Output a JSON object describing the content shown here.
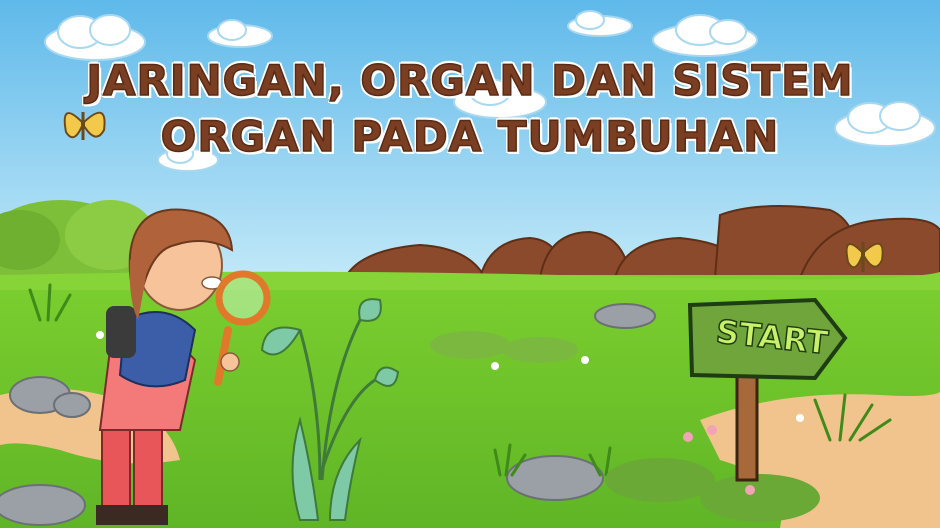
{
  "title": {
    "line1": "JARINGAN, ORGAN DAN SISTEM",
    "line2": "ORGAN PADA TUMBUHAN"
  },
  "start_button": {
    "label": "START"
  },
  "colors": {
    "sky_top": "#5fb9ea",
    "sky_bottom": "#bfe6f7",
    "grass": "#6fc42a",
    "grass_dark": "#4e9b1e",
    "rock": "#8b4a2b",
    "path": "#f1c48e",
    "title_text": "#7a3f22",
    "sign_board": "#6fa53a",
    "sign_text": "#c9f06a"
  },
  "icons": [
    "cloud-icon",
    "butterfly-icon",
    "magnifying-glass-icon",
    "signpost-icon",
    "flower-icon",
    "rock-icon"
  ]
}
